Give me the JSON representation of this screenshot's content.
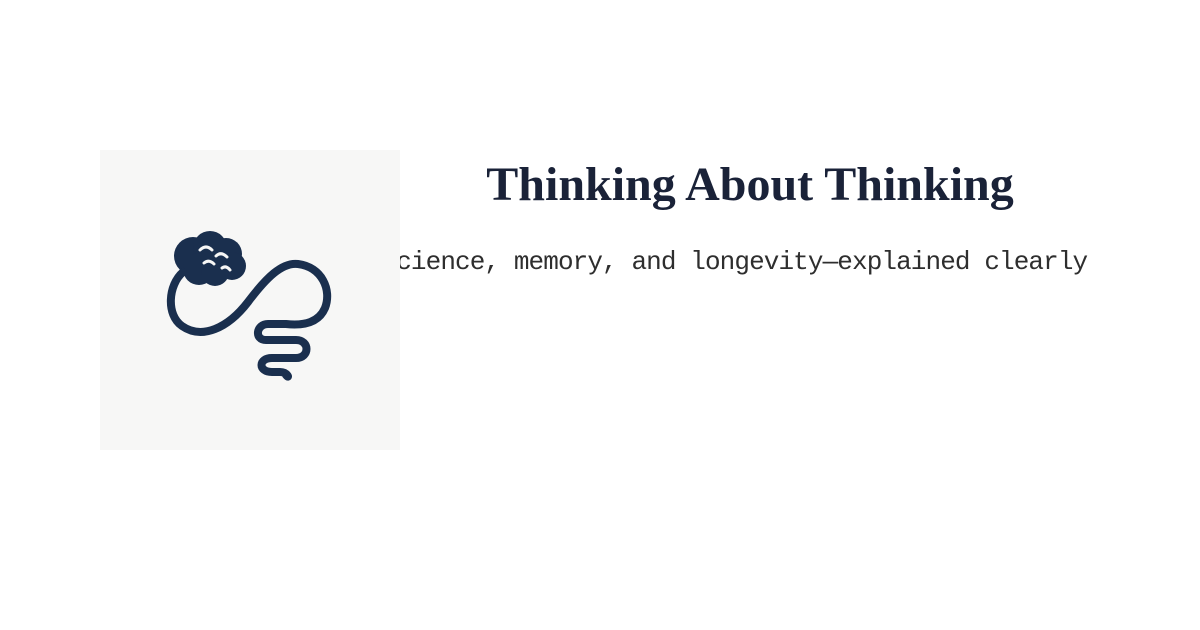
{
  "card": {
    "title": "Thinking About Thinking",
    "subtitle": "Neuroscience, memory, and longevity—explained clearly"
  },
  "logo": {
    "icon": "brain-with-winding-path-icon",
    "color": "#1a2f4e",
    "background": "#f7f7f6"
  }
}
